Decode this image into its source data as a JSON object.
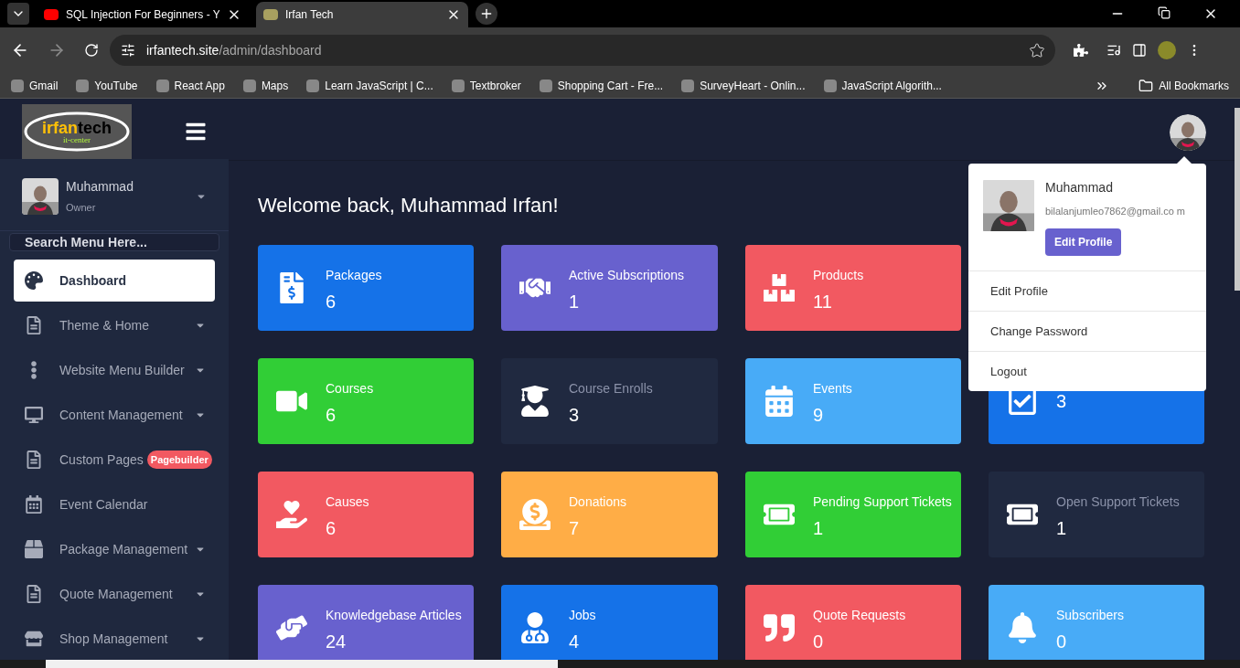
{
  "browser": {
    "tabs": [
      {
        "title": "SQL Injection For Beginners - Y",
        "selected": false
      },
      {
        "title": "Irfan Tech",
        "selected": true
      }
    ],
    "url_host": "irfantech.site",
    "url_path": "/admin/dashboard",
    "bookmarks": [
      {
        "label": "Gmail"
      },
      {
        "label": "YouTube"
      },
      {
        "label": "React App"
      },
      {
        "label": "Maps"
      },
      {
        "label": "Learn JavaScript | C..."
      },
      {
        "label": "Textbroker"
      },
      {
        "label": "Shopping Cart - Fre..."
      },
      {
        "label": "SurveyHeart - Onlin..."
      },
      {
        "label": "JavaScript Algorith..."
      }
    ],
    "all_bookmarks": "All Bookmarks"
  },
  "logo": {
    "title_accent": "irfan",
    "title_rest": "tech",
    "subtitle": "it-center"
  },
  "sidebar": {
    "user": {
      "name": "Muhammad",
      "role": "Owner"
    },
    "search": {
      "placeholder": "Search Menu Here..."
    },
    "items": [
      {
        "label": "Dashboard",
        "selected": true,
        "submenu": false
      },
      {
        "label": "Theme & Home",
        "selected": false,
        "submenu": true
      },
      {
        "label": "Website Menu Builder",
        "selected": false,
        "submenu": true
      },
      {
        "label": "Content Management",
        "selected": false,
        "submenu": true
      },
      {
        "label": "Custom Pages",
        "selected": false,
        "submenu": false,
        "badge": "Pagebuilder"
      },
      {
        "label": "Event Calendar",
        "selected": false,
        "submenu": false
      },
      {
        "label": "Package Management",
        "selected": false,
        "submenu": true
      },
      {
        "label": "Quote Management",
        "selected": false,
        "submenu": true
      },
      {
        "label": "Shop Management",
        "selected": false,
        "submenu": true
      }
    ]
  },
  "welcome": "Welcome back, Muhammad Irfan!",
  "card_rows": [
    {
      "cards": [
        {
          "label": "Packages",
          "value": "6",
          "color": "#1572e8"
        },
        {
          "label": "Active Subscriptions",
          "value": "1",
          "color": "#6861ce"
        },
        {
          "label": "Products",
          "value": "11",
          "color": "#f25961"
        }
      ]
    },
    {
      "cards": [
        {
          "label": "Courses",
          "value": "6",
          "color": "#31ce36"
        },
        {
          "label": "Course Enrolls",
          "value": "3",
          "color": "#202940"
        },
        {
          "label": "Events",
          "value": "9",
          "color": "#48abf7"
        },
        {
          "value": "3",
          "color": "#1572e8"
        }
      ]
    },
    {
      "cards": [
        {
          "label": "Causes",
          "value": "6",
          "color": "#f25961"
        },
        {
          "label": "Donations",
          "value": "7",
          "color": "#ffad46"
        },
        {
          "label": "Pending Support Tickets",
          "value": "1",
          "color": "#31ce36"
        },
        {
          "label": "Open Support Tickets",
          "value": "1",
          "color": "#202940"
        }
      ]
    },
    {
      "cards": [
        {
          "label": "Knowledgebase Articles",
          "value": "24",
          "color": "#6861ce"
        },
        {
          "label": "Jobs",
          "value": "4",
          "color": "#1572e8"
        },
        {
          "label": "Quote Requests",
          "value": "0",
          "color": "#f25961"
        },
        {
          "label": "Subscribers",
          "value": "0",
          "color": "#48abf7"
        }
      ]
    }
  ],
  "profile_menu": {
    "name": "Muhammad",
    "email": "bilalanjumleo7862@gmail.co m",
    "button": "Edit Profile",
    "items": [
      {
        "label": "Edit Profile"
      },
      {
        "label": "Change Password"
      },
      {
        "label": "Logout"
      }
    ]
  }
}
